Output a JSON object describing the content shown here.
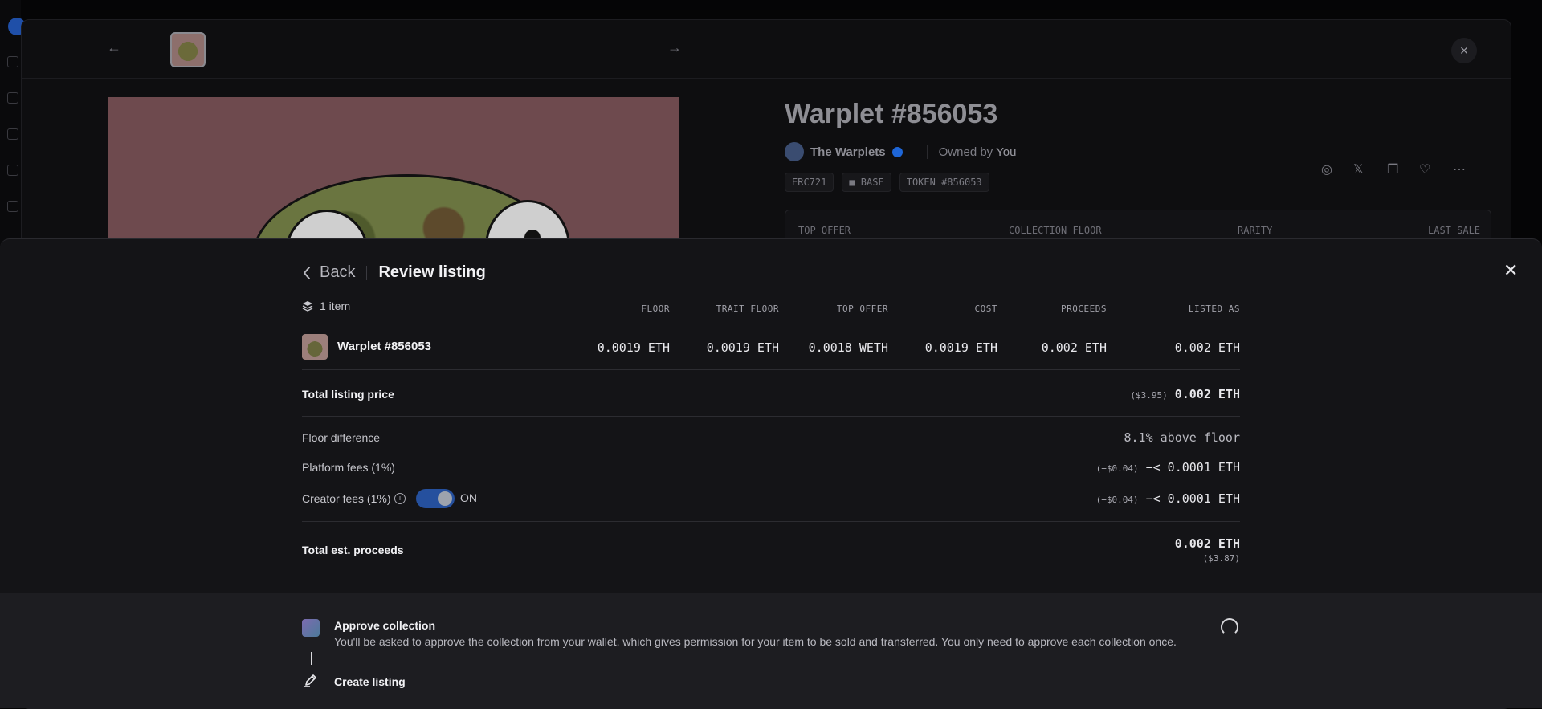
{
  "background_page": {
    "nft_title": "Warplet #856053",
    "collection_name": "The Warplets",
    "owned_by_prefix": "Owned by",
    "owned_by_value": "You",
    "chips": [
      "ERC721",
      "■ BASE",
      "TOKEN #856053"
    ],
    "stats": [
      "TOP OFFER",
      "COLLECTION FLOOR",
      "RARITY",
      "LAST SALE"
    ],
    "icons": {
      "prev": "←",
      "next": "→",
      "close": "×",
      "globe": "◎",
      "x": "𝕏",
      "copy": "❐",
      "heart": "♡",
      "more": "⋯"
    }
  },
  "review": {
    "back_label": "Back",
    "title": "Review listing",
    "items_count": "1 item",
    "columns": [
      "FLOOR",
      "TRAIT FLOOR",
      "TOP OFFER",
      "COST",
      "PROCEEDS",
      "LISTED AS"
    ],
    "item": {
      "name": "Warplet #856053",
      "floor": "0.0019 ETH",
      "trait_floor": "0.0019 ETH",
      "top_offer": "0.0018 WETH",
      "cost": "0.0019 ETH",
      "proceeds": "0.002 ETH",
      "listed_as": "0.002 ETH"
    },
    "total_listing_price": {
      "label": "Total listing price",
      "usd": "($3.95)",
      "value": "0.002 ETH"
    },
    "floor_difference": {
      "label": "Floor difference",
      "value": "8.1% above floor"
    },
    "platform_fees": {
      "label": "Platform fees (1%)",
      "usd": "(−$0.04)",
      "value": "−< 0.0001 ETH"
    },
    "creator_fees": {
      "label": "Creator fees (1%)",
      "toggle_state": "ON",
      "usd": "(−$0.04)",
      "value": "−< 0.0001 ETH"
    },
    "total_proceeds": {
      "label": "Total est. proceeds",
      "value": "0.002 ETH",
      "usd": "($3.87)"
    },
    "close_icon": "✕"
  },
  "steps": {
    "approve": {
      "title": "Approve collection",
      "description": "You'll be asked to approve the collection from your wallet, which gives permission for your item to be sold and transferred. You only need to approve each collection once."
    },
    "create": {
      "title": "Create listing"
    }
  }
}
